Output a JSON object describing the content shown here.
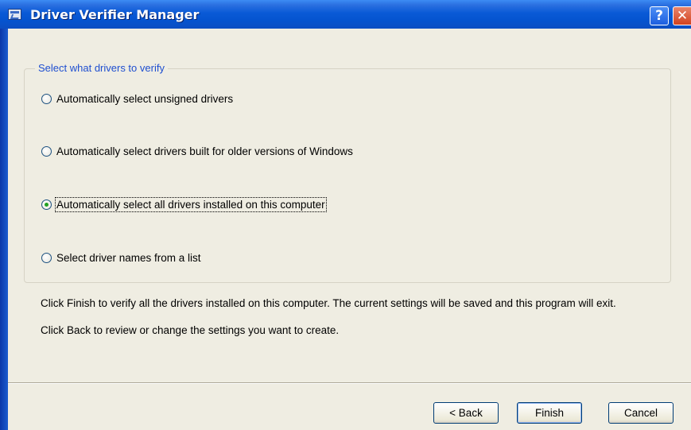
{
  "window": {
    "title": "Driver Verifier Manager",
    "help_glyph": "?",
    "close_glyph": "✕"
  },
  "group": {
    "label": "Select what drivers to verify"
  },
  "options": [
    {
      "label": "Automatically select unsigned drivers",
      "checked": false
    },
    {
      "label": "Automatically select drivers built for older versions of Windows",
      "checked": false
    },
    {
      "label": "Automatically select all drivers installed on this computer",
      "checked": true
    },
    {
      "label": "Select driver names from a list",
      "checked": false
    }
  ],
  "info": {
    "line1": "Click Finish to verify all the drivers installed on this computer. The current settings will be saved and this program will exit.",
    "line2": "Click Back to review or change the settings you want to create."
  },
  "buttons": {
    "back": "< Back",
    "finish": "Finish",
    "cancel": "Cancel"
  },
  "colors": {
    "titlebar": "#0554d0",
    "dialog_bg": "#efede2",
    "group_label": "#1f4fd0",
    "radio_dot": "#21a121"
  }
}
